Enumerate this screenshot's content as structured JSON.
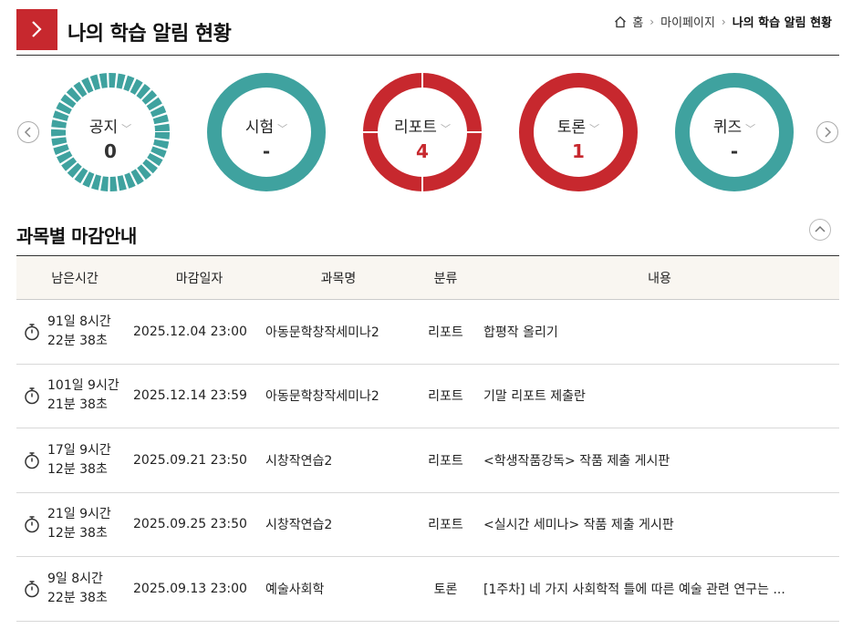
{
  "header": {
    "title": "나의 학습 알림 현황",
    "breadcrumb": [
      "홈",
      "마이페이지",
      "나의 학습 알림 현황"
    ]
  },
  "summary": [
    {
      "label": "공지",
      "count": "0",
      "color": "#3fa29f",
      "style": "dashed"
    },
    {
      "label": "시험",
      "count": "-",
      "color": "#3fa29f",
      "style": "solid"
    },
    {
      "label": "리포트",
      "count": "4",
      "color": "#c7282e",
      "style": "quartered"
    },
    {
      "label": "토론",
      "count": "1",
      "color": "#c7282e",
      "style": "solid"
    },
    {
      "label": "퀴즈",
      "count": "-",
      "color": "#3fa29f",
      "style": "solid"
    }
  ],
  "section": {
    "title": "과목별 마감안내"
  },
  "table": {
    "headers": [
      "남은시간",
      "마감일자",
      "과목명",
      "분류",
      "내용"
    ],
    "rows": [
      {
        "time1": "91일 8시간",
        "time2": "22분 38초",
        "date": "2025.12.04 23:00",
        "course": "아동문학창작세미나2",
        "cat": "리포트",
        "content": "합평작 올리기"
      },
      {
        "time1": "101일 9시간",
        "time2": "21분 38초",
        "date": "2025.12.14 23:59",
        "course": "아동문학창작세미나2",
        "cat": "리포트",
        "content": "기말 리포트 제출란"
      },
      {
        "time1": "17일 9시간",
        "time2": "12분 38초",
        "date": "2025.09.21 23:50",
        "course": "시창작연습2",
        "cat": "리포트",
        "content": "<학생작품강독> 작품 제출 게시판"
      },
      {
        "time1": "21일 9시간",
        "time2": "12분 38초",
        "date": "2025.09.25 23:50",
        "course": "시창작연습2",
        "cat": "리포트",
        "content": "<실시간 세미나> 작품 제출 게시판"
      },
      {
        "time1": "9일 8시간",
        "time2": "22분 38초",
        "date": "2025.09.13 23:00",
        "course": "예술사회학",
        "cat": "토론",
        "content": "[1주차] 네 가지 사회학적 틀에 따른 예술 관련 연구는 ..."
      }
    ]
  },
  "colors": {
    "accent": "#c7282e",
    "teal": "#3fa29f"
  }
}
